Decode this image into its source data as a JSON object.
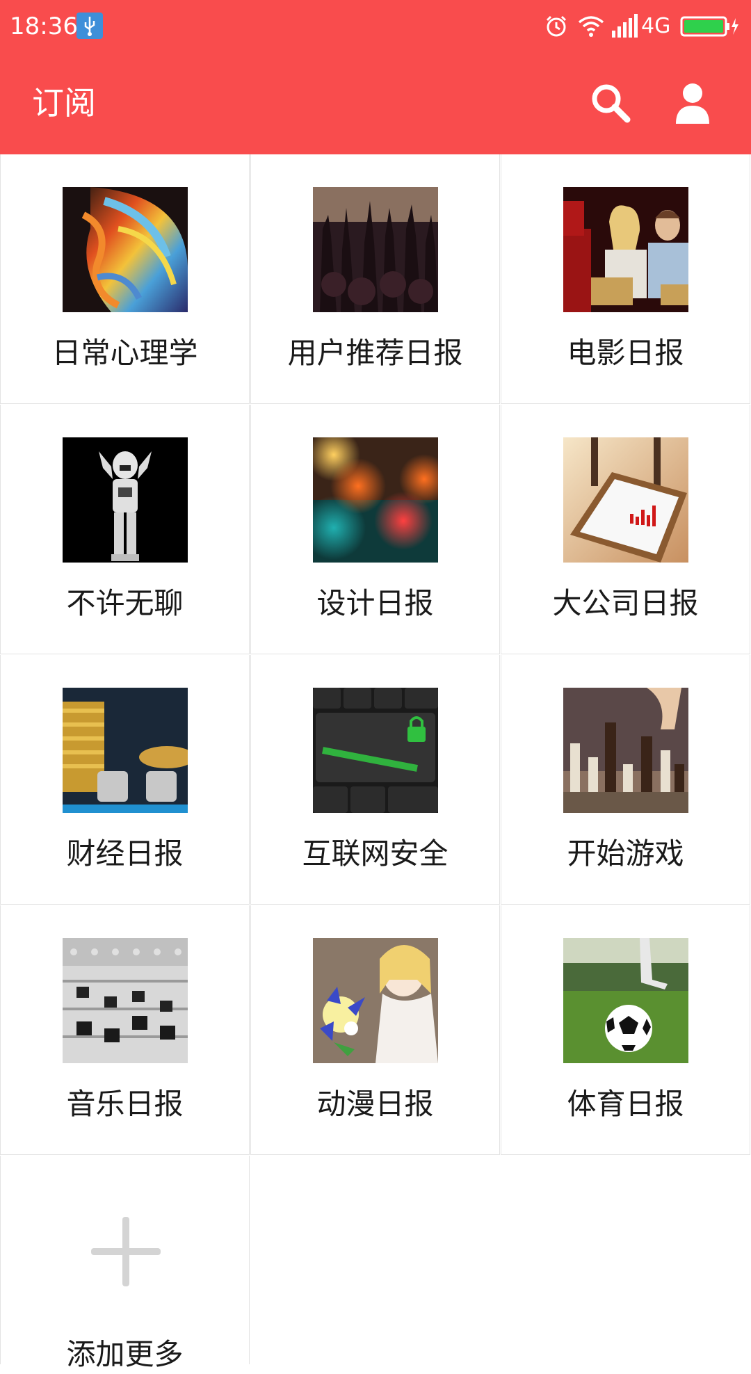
{
  "status_bar": {
    "time": "18:36",
    "network": "4G",
    "icons": [
      "usb-icon",
      "alarm-icon",
      "wifi-icon",
      "signal-icon",
      "battery-icon"
    ]
  },
  "app_bar": {
    "title": "订阅",
    "actions": [
      "search-icon",
      "account-icon"
    ],
    "background_color": "#f94c4d"
  },
  "subscriptions": [
    {
      "label": "日常心理学",
      "image": "colorful-face-art"
    },
    {
      "label": "用户推荐日报",
      "image": "concert-crowd"
    },
    {
      "label": "电影日报",
      "image": "couple-in-cinema"
    },
    {
      "label": "不许无聊",
      "image": "stormtrooper-figure"
    },
    {
      "label": "设计日报",
      "image": "bokeh-lights"
    },
    {
      "label": "大公司日报",
      "image": "tablet-with-chart"
    },
    {
      "label": "财经日报",
      "image": "coins-buy-sell-dice"
    },
    {
      "label": "互联网安全",
      "image": "protection-keyboard-key"
    },
    {
      "label": "开始游戏",
      "image": "chess-pieces"
    },
    {
      "label": "音乐日报",
      "image": "mixing-console"
    },
    {
      "label": "动漫日报",
      "image": "anime-girl-bouquet"
    },
    {
      "label": "体育日报",
      "image": "soccer-ball-on-grass"
    }
  ],
  "add_more": {
    "label": "添加更多",
    "icon": "plus-icon"
  }
}
